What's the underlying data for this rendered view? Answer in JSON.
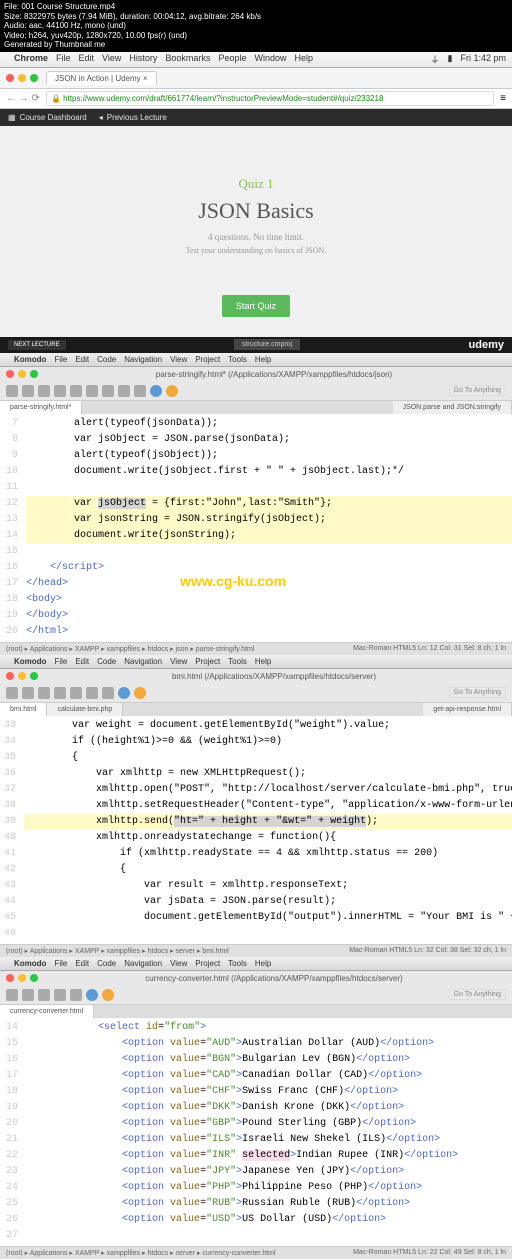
{
  "meta": {
    "file": "File: 001 Course Structure.mp4",
    "size": "Size: 8322975 bytes (7.94 MiB), duration: 00:04:12, avg.bitrate: 264 kb/s",
    "audio": "Audio: aac, 44100 Hz, mono (und)",
    "video": "Video: h264, yuv420p, 1280x720, 10.00 fps(r) (und)",
    "gen": "Generated by Thumbnail me"
  },
  "mac_menu": {
    "app": "Chrome",
    "items": [
      "File",
      "Edit",
      "View",
      "History",
      "Bookmarks",
      "People",
      "Window",
      "Help"
    ],
    "time": "Fri 1:42 pm"
  },
  "browser": {
    "tab_title": "JSON in Action | Udemy",
    "url": "https://www.udemy.com/draft/661774/learn/?instructorPreviewMode=student#/quiz/233218"
  },
  "dark_nav": {
    "dashboard": "Course Dashboard",
    "prev": "Previous Lecture"
  },
  "quiz": {
    "label": "Quiz 1",
    "title": "JSON Basics",
    "sub": "4 questions. No time limit.",
    "desc": "Test your understanding on basics of JSON.",
    "start": "Start Quiz"
  },
  "footer": {
    "next": "NEXT LECTURE",
    "file_tab": "structure.cmproj",
    "brand": "udemy"
  },
  "komodo1": {
    "app": "Komodo",
    "menu": [
      "File",
      "Edit",
      "Code",
      "Navigation",
      "View",
      "Project",
      "Tools",
      "Help"
    ],
    "go": "Go To Anything",
    "path": "parse-stringify.html* (/Applications/XAMPP/xamppfiles/htdocs/json)",
    "tabs": [
      "parse-stringify.html*",
      "JSON.parse and JSON.stringify"
    ],
    "lines": [
      "7",
      "8",
      "9",
      "10",
      "11",
      "12",
      "13",
      "14",
      "15",
      "16",
      "17",
      "18",
      "19",
      "20"
    ],
    "code": {
      "l7": "        alert(typeof(jsonData));",
      "l8": "        var jsObject = JSON.parse(jsonData);",
      "l9": "        alert(typeof(jsObject));",
      "l10": "        document.write(jsObject.first + \" \" + jsObject.last);*/",
      "l11": "",
      "l12a": "        var ",
      "l12b": "jsObject",
      "l12c": " = {first:\"John\",last:\"Smith\"};",
      "l13": "        var jsonString = JSON.stringify(jsObject);",
      "l14": "        document.write(jsonString);",
      "l15": "",
      "l16": "    </script>",
      "l17": "</head>",
      "l18": "<body>",
      "l19": "</body>",
      "l20": "</html>"
    },
    "watermark": "www.cg-ku.com",
    "status_left": "(root) ▸ Applications ▸ XAMPP ▸ xamppfiles ▸ htdocs ▸ json ▸ parse-stringify.html",
    "status_right": "Mac-Roman   HTML5   Ln: 12 Col: 31   Sel: 8 ch, 1 ln"
  },
  "komodo2": {
    "path": "bmi.html (/Applications/XAMPP/xamppfiles/htdocs/server)",
    "tabs": [
      "bmi.html",
      "calculate-bmi.php",
      "get-api-response.html"
    ],
    "lines": [
      "33",
      "34",
      "35",
      "36",
      "37",
      "38",
      "39",
      "40",
      "41",
      "42",
      "43",
      "44",
      "45",
      "46"
    ],
    "code": {
      "l33": "        var weight = document.getElementById(\"weight\").value;",
      "l34": "        if ((height%1)>=0 && (weight%1)>=0)",
      "l35": "        {",
      "l36": "            var xmlhttp = new XMLHttpRequest();",
      "l37": "            xmlhttp.open(\"POST\", \"http://localhost/server/calculate-bmi.php\", true);",
      "l38": "            xmlhttp.setRequestHeader(\"Content-type\", \"application/x-www-form-urlenc",
      "l39a": "            xmlhttp.send(",
      "l39b": "\"ht=\" + height + \"&wt=\" + weight",
      "l39c": ");",
      "l40": "            xmlhttp.onreadystatechange = function(){",
      "l41": "                if (xmlhttp.readyState == 4 && xmlhttp.status == 200)",
      "l42": "                {",
      "l43": "                    var result = xmlhttp.responseText;",
      "l44": "                    var jsData = JSON.parse(result);",
      "l45": "                    document.getElementById(\"output\").innerHTML = \"Your BMI is \" + j",
      "l46": ""
    },
    "status_left": "(root) ▸ Applications ▸ XAMPP ▸ xamppfiles ▸ htdocs ▸ server ▸ bmi.html",
    "status_right": "Mac-Roman   HTML5   Ln: 32 Col: 38   Sel: 32 ch, 1 ln"
  },
  "komodo3": {
    "path": "currency-converter.html (/Applications/XAMPP/xamppfiles/htdocs/server)",
    "tabs": [
      "currency-converter.html"
    ],
    "lines": [
      "14",
      "15",
      "16",
      "17",
      "18",
      "19",
      "20",
      "21",
      "22",
      "23",
      "24",
      "25",
      "26",
      "27"
    ],
    "options": [
      {
        "ln": "15",
        "val": "AUD",
        "txt": "Australian Dollar (AUD)"
      },
      {
        "ln": "16",
        "val": "BGN",
        "txt": "Bulgarian Lev (BGN)"
      },
      {
        "ln": "17",
        "val": "CAD",
        "txt": "Canadian Dollar (CAD)"
      },
      {
        "ln": "18",
        "val": "CHF",
        "txt": "Swiss Franc (CHF)"
      },
      {
        "ln": "19",
        "val": "DKK",
        "txt": "Danish Krone (DKK)"
      },
      {
        "ln": "20",
        "val": "GBP",
        "txt": "Pound Sterling (GBP)"
      },
      {
        "ln": "21",
        "val": "ILS",
        "txt": "Israeli New Shekel (ILS)"
      },
      {
        "ln": "22",
        "val": "INR",
        "txt": "Indian Rupee (INR)",
        "sel": true
      },
      {
        "ln": "23",
        "val": "JPY",
        "txt": "Japanese Yen (JPY)"
      },
      {
        "ln": "24",
        "val": "PHP",
        "txt": "Philippine Peso (PHP)"
      },
      {
        "ln": "25",
        "val": "RUB",
        "txt": "Russian Ruble (RUB)"
      },
      {
        "ln": "26",
        "val": "USD",
        "txt": "US Dollar (USD)"
      }
    ],
    "l14": "            <select id=\"from\">",
    "l27": "",
    "status_left": "(root) ▸ Applications ▸ XAMPP ▸ xamppfiles ▸ htdocs ▸ server ▸ currency-converter.html",
    "status_right": "Mac-Roman   HTML5   Ln: 22 Col: 49   Sel: 8 ch, 1 ln"
  }
}
